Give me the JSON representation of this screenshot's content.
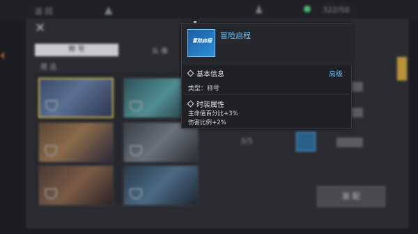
{
  "top_bar": {
    "left_text": "返 回",
    "resource_value": "322/50"
  },
  "tabs": {
    "active": "称 号",
    "inactive": "头 像"
  },
  "filter_label": "筛 选",
  "equip_button": "装 配",
  "side_value": "3/5",
  "popup": {
    "icon_text": "冒险启程",
    "title": "冒险启程",
    "basic_info_header": "基本信息",
    "rarity": "高级",
    "type_line": "类型：称号",
    "costume_attr_header": "时装属性",
    "attributes": [
      "主命值百分比+3%",
      "伤害比例+2%"
    ]
  },
  "colors": {
    "accent_blue": "#5fc2ff",
    "selected_gold": "#c9b24a",
    "background": "#1b1c20"
  }
}
